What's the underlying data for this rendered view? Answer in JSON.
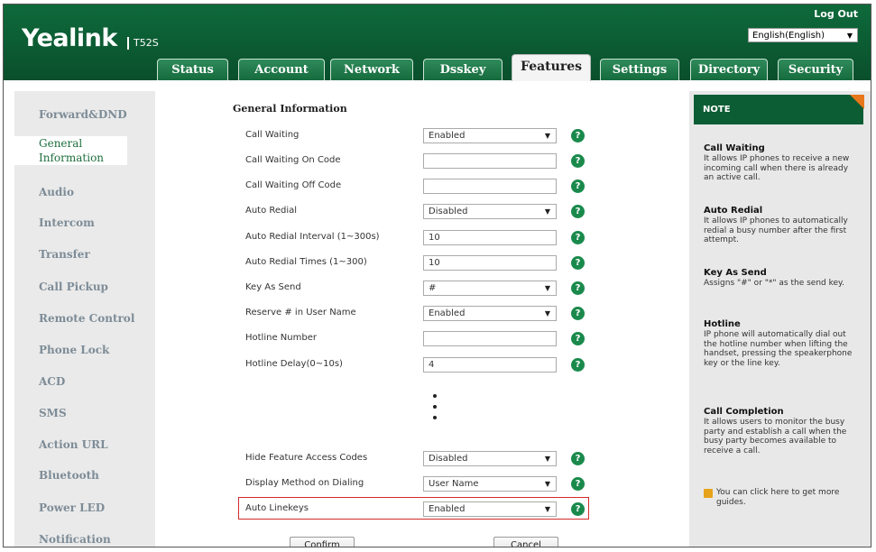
{
  "brand": {
    "logo": "Yealink",
    "model": "T52S"
  },
  "header": {
    "logout": "Log Out",
    "language": "English(English)"
  },
  "tabs": [
    {
      "label": "Status"
    },
    {
      "label": "Account"
    },
    {
      "label": "Network"
    },
    {
      "label": "Dsskey"
    },
    {
      "label": "Features",
      "active": true
    },
    {
      "label": "Settings"
    },
    {
      "label": "Directory"
    },
    {
      "label": "Security"
    }
  ],
  "sidebar": {
    "items": [
      {
        "label": "Forward&DND"
      },
      {
        "label": "General Information",
        "active": true
      },
      {
        "label": "Audio"
      },
      {
        "label": "Intercom"
      },
      {
        "label": "Transfer"
      },
      {
        "label": "Call Pickup"
      },
      {
        "label": "Remote Control"
      },
      {
        "label": "Phone Lock"
      },
      {
        "label": "ACD"
      },
      {
        "label": "SMS"
      },
      {
        "label": "Action URL"
      },
      {
        "label": "Bluetooth"
      },
      {
        "label": "Power LED"
      },
      {
        "label": "Notification Popups"
      }
    ]
  },
  "form": {
    "section_title": "General Information",
    "rows": [
      {
        "label": "Call Waiting",
        "value": "Enabled",
        "type": "select"
      },
      {
        "label": "Call Waiting On Code",
        "value": "",
        "type": "input"
      },
      {
        "label": "Call Waiting Off Code",
        "value": "",
        "type": "input"
      },
      {
        "label": "Auto Redial",
        "value": "Disabled",
        "type": "select"
      },
      {
        "label": "Auto Redial Interval (1~300s)",
        "value": "10",
        "type": "input"
      },
      {
        "label": "Auto Redial Times (1~300)",
        "value": "10",
        "type": "input"
      },
      {
        "label": "Key As Send",
        "value": "#",
        "type": "select"
      },
      {
        "label": "Reserve # in User Name",
        "value": "Enabled",
        "type": "select"
      },
      {
        "label": "Hotline Number",
        "value": "",
        "type": "input"
      },
      {
        "label": "Hotline Delay(0~10s)",
        "value": "4",
        "type": "input"
      },
      {
        "label": "Hide Feature Access Codes",
        "value": "Disabled",
        "type": "select"
      },
      {
        "label": "Display Method on Dialing",
        "value": "User Name",
        "type": "select"
      },
      {
        "label": "Auto Linekeys",
        "value": "Enabled",
        "type": "select",
        "highlighted": true
      }
    ],
    "help_glyph": "?",
    "confirm_label": "Confirm",
    "cancel_label": "Cancel"
  },
  "note": {
    "title": "NOTE",
    "entries": [
      {
        "title": "Call Waiting",
        "text": "It allows IP phones to receive a new incoming call when there is already an active call."
      },
      {
        "title": "Auto Redial",
        "text": "It allows IP phones to automatically redial a busy number after the first attempt."
      },
      {
        "title": "Key As Send",
        "text": "Assigns \"#\" or \"*\" as the send key."
      },
      {
        "title": "Hotline",
        "text": "IP phone will automatically dial out the hotline number when lifting the handset, pressing the speakerphone key or the line key."
      },
      {
        "title": "Call Completion",
        "text": "It allows users to monitor the busy party and establish a call when the busy party becomes available to receive a call."
      }
    ],
    "guide_text": "You can click here to get more guides."
  },
  "colors": {
    "brand_green": "#0e6a3b",
    "accent_orange": "#e8761a",
    "highlight_red": "#d42a2a",
    "help_green": "#1a8a4c"
  }
}
